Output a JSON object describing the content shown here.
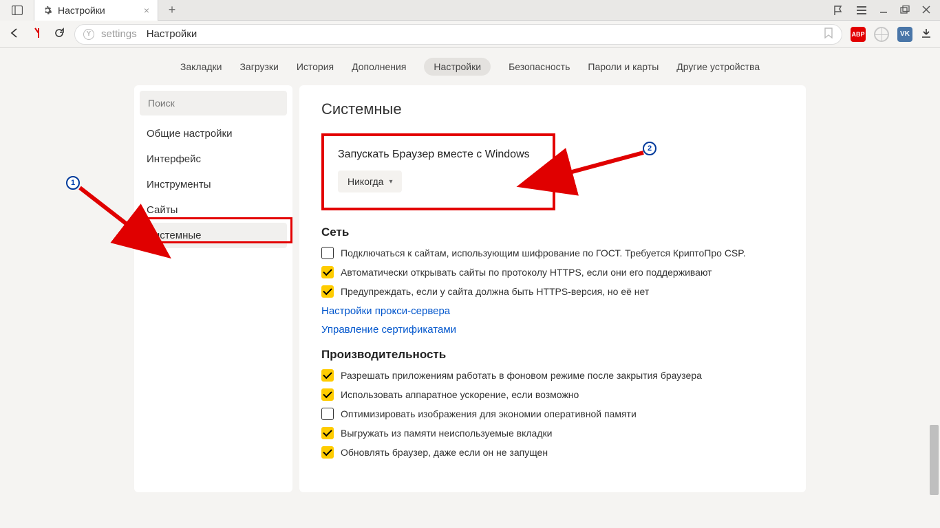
{
  "titlebar": {
    "tab_title": "Настройки"
  },
  "omnibox": {
    "scheme": "settings",
    "title": "Настройки"
  },
  "topnav": {
    "items": [
      {
        "label": "Закладки"
      },
      {
        "label": "Загрузки"
      },
      {
        "label": "История"
      },
      {
        "label": "Дополнения"
      },
      {
        "label": "Настройки",
        "active": true
      },
      {
        "label": "Безопасность"
      },
      {
        "label": "Пароли и карты"
      },
      {
        "label": "Другие устройства"
      }
    ]
  },
  "sidebar": {
    "search_placeholder": "Поиск",
    "items": [
      {
        "label": "Общие настройки"
      },
      {
        "label": "Интерфейс"
      },
      {
        "label": "Инструменты"
      },
      {
        "label": "Сайты"
      },
      {
        "label": "Системные",
        "active": true
      }
    ]
  },
  "content": {
    "heading": "Системные",
    "startup": {
      "title": "Запускать Браузер вместе с Windows",
      "dropdown_value": "Никогда"
    },
    "network": {
      "heading": "Сеть",
      "items": [
        {
          "checked": false,
          "label": "Подключаться к сайтам, использующим шифрование по ГОСТ. Требуется КриптоПро CSP."
        },
        {
          "checked": true,
          "label": "Автоматически открывать сайты по протоколу HTTPS, если они его поддерживают"
        },
        {
          "checked": true,
          "label": "Предупреждать, если у сайта должна быть HTTPS-версия, но её нет"
        }
      ],
      "links": [
        "Настройки прокси-сервера",
        "Управление сертификатами"
      ]
    },
    "performance": {
      "heading": "Производительность",
      "items": [
        {
          "checked": true,
          "label": "Разрешать приложениям работать в фоновом режиме после закрытия браузера"
        },
        {
          "checked": true,
          "label": "Использовать аппаратное ускорение, если возможно"
        },
        {
          "checked": false,
          "label": "Оптимизировать изображения для экономии оперативной памяти"
        },
        {
          "checked": true,
          "label": "Выгружать из памяти неиспользуемые вкладки"
        },
        {
          "checked": true,
          "label": "Обновлять браузер, даже если он не запущен"
        }
      ]
    }
  },
  "annotations": {
    "marker1": "1",
    "marker2": "2"
  },
  "ext": {
    "abp": "ABP",
    "vk": "VK"
  }
}
